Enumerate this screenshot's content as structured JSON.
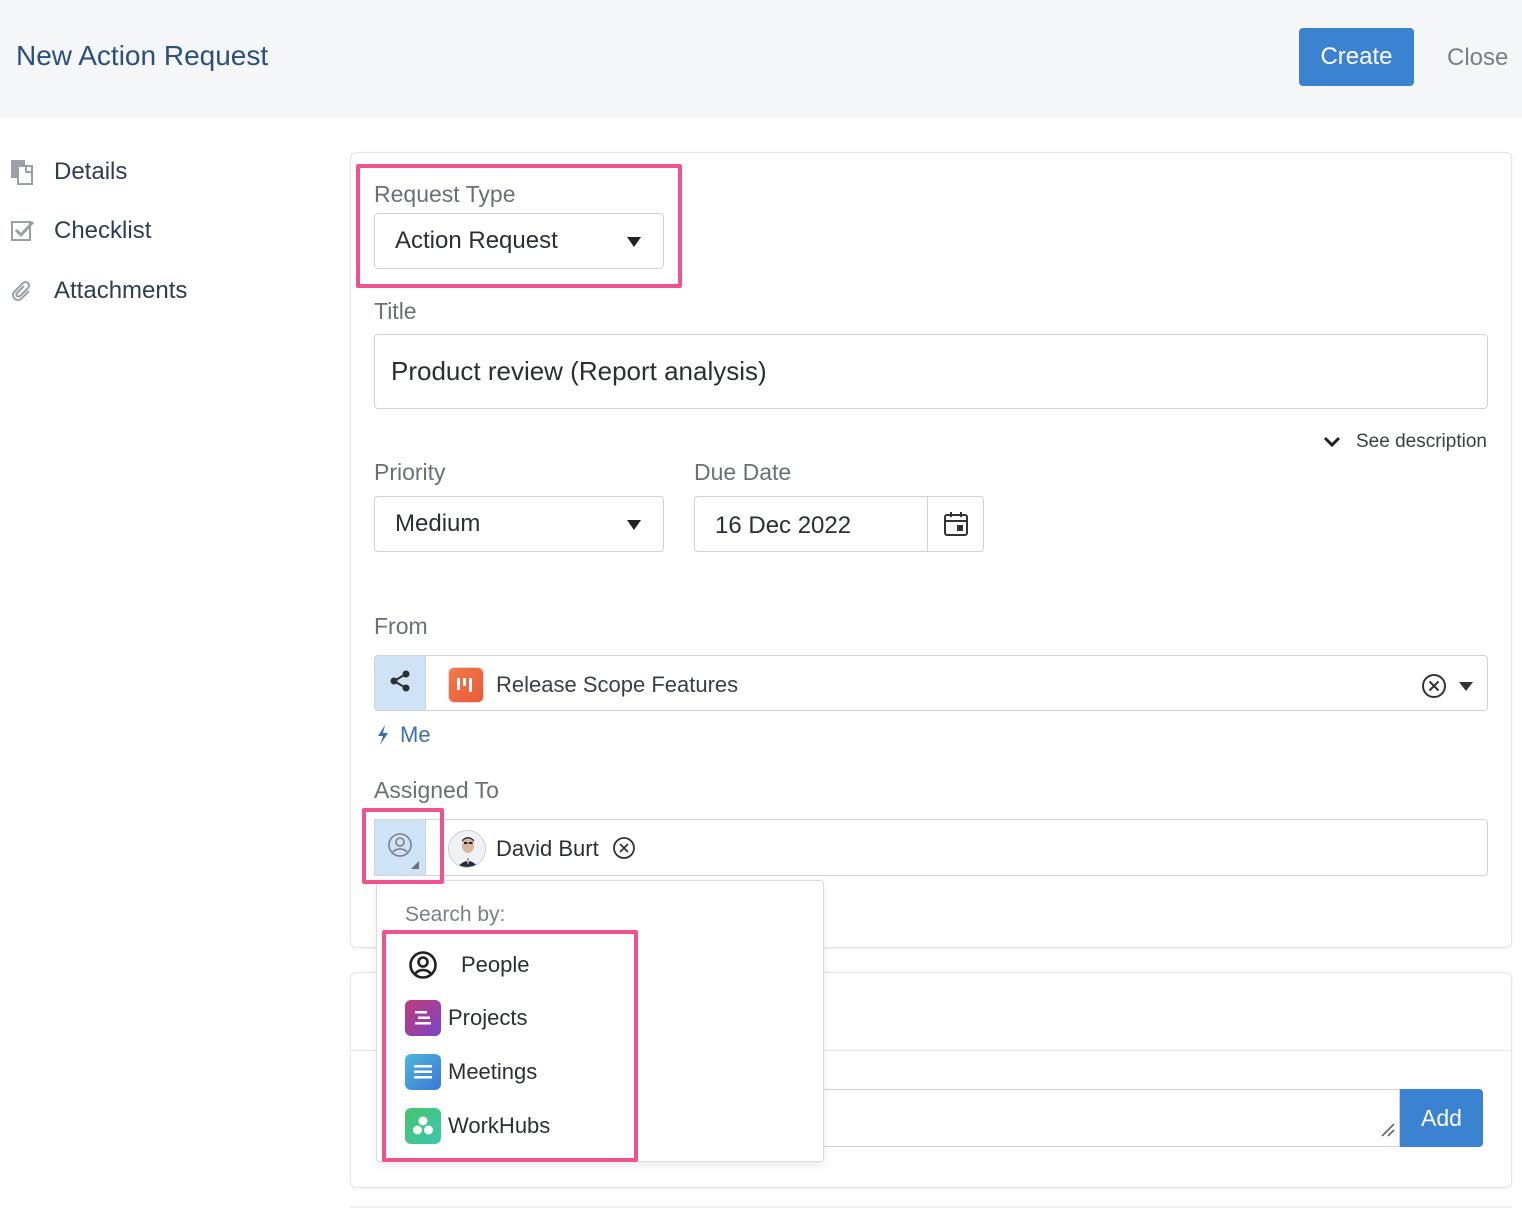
{
  "header": {
    "title": "New Action Request",
    "create_label": "Create",
    "close_label": "Close"
  },
  "sidebar": {
    "items": [
      {
        "label": "Details",
        "icon": "document-icon"
      },
      {
        "label": "Checklist",
        "icon": "checkbox-icon"
      },
      {
        "label": "Attachments",
        "icon": "paperclip-icon"
      }
    ]
  },
  "form": {
    "request_type": {
      "label": "Request Type",
      "value": "Action Request"
    },
    "title": {
      "label": "Title",
      "value": "Product review (Report analysis)"
    },
    "see_description": "See description",
    "priority": {
      "label": "Priority",
      "value": "Medium"
    },
    "due_date": {
      "label": "Due Date",
      "value": "16 Dec 2022"
    },
    "from": {
      "label": "From",
      "value": "Release Scope Features",
      "me_link": "Me"
    },
    "assigned_to": {
      "label": "Assigned To",
      "value": "David Burt"
    }
  },
  "search_dropdown": {
    "title": "Search by:",
    "options": [
      {
        "label": "People",
        "icon": "person-circle-icon"
      },
      {
        "label": "Projects",
        "icon": "projects-icon",
        "color": "#b83f8f"
      },
      {
        "label": "Meetings",
        "icon": "meetings-icon",
        "color": "#3aa0d8"
      },
      {
        "label": "WorkHubs",
        "icon": "workhubs-icon",
        "color": "#43c38a"
      }
    ]
  },
  "comments": {
    "add_label": "Add"
  },
  "colors": {
    "accent": "#3b82d0",
    "highlight": "#f0528f",
    "title": "#2c4f7c"
  }
}
